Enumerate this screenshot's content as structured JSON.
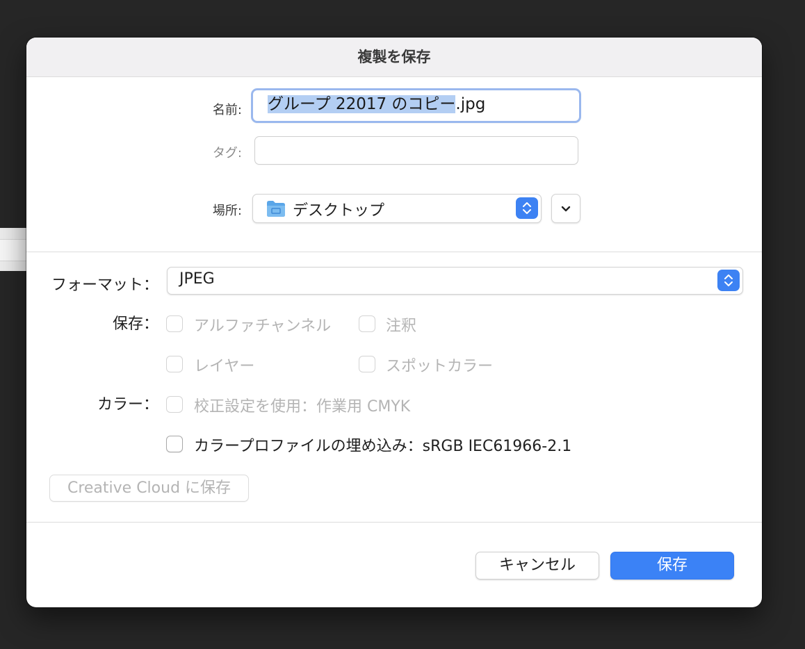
{
  "dialog": {
    "title": "複製を保存",
    "name": {
      "label": "名前:",
      "value_selected": "グループ 22017 のコピー",
      "value_extension": ".jpg"
    },
    "tags": {
      "label": "タグ:",
      "value": ""
    },
    "location": {
      "label": "場所:",
      "value": "デスクトップ",
      "icon": "folder-icon"
    },
    "format": {
      "label": "フォーマット：",
      "value": "JPEG"
    },
    "save_options": {
      "label": "保存：",
      "items": [
        {
          "label": "アルファチャンネル",
          "checked": false,
          "enabled": false
        },
        {
          "label": "注釈",
          "checked": false,
          "enabled": false
        },
        {
          "label": "レイヤー",
          "checked": false,
          "enabled": false
        },
        {
          "label": "スポットカラー",
          "checked": false,
          "enabled": false
        }
      ]
    },
    "color_options": {
      "label": "カラー：",
      "items": [
        {
          "label": "校正設定を使用：作業用 CMYK",
          "checked": false,
          "enabled": false
        },
        {
          "label": "カラープロファイルの埋め込み：sRGB IEC61966-2.1",
          "checked": false,
          "enabled": true
        }
      ]
    },
    "creative_cloud_button": "Creative Cloud に保存",
    "cancel_button": "キャンセル",
    "save_button": "保存"
  },
  "colors": {
    "accent": "#3b82f6",
    "selection": "#b3cef3",
    "focus_ring": "#9ab8ee"
  }
}
